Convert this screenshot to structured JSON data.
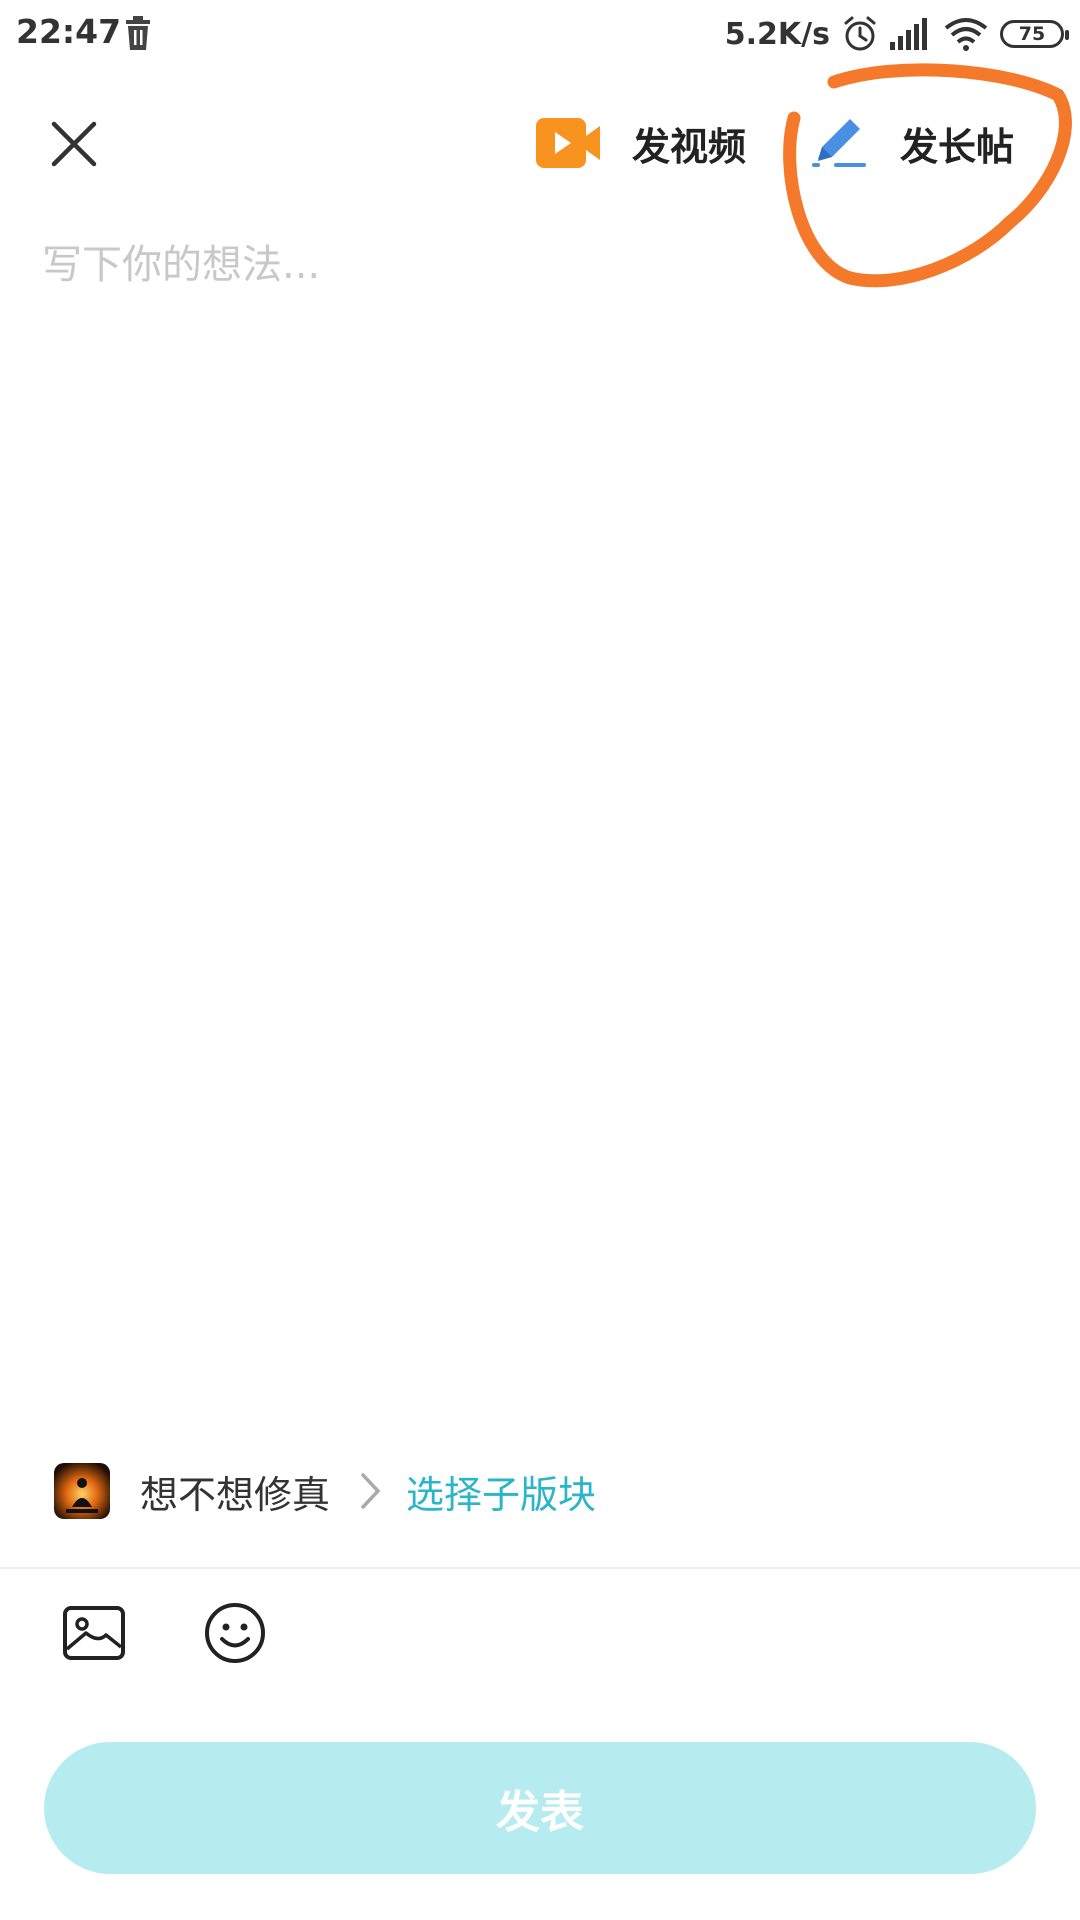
{
  "status_bar": {
    "time": "22:47",
    "net_speed": "5.2K/s",
    "battery": "75",
    "icons": [
      "trash-icon",
      "alarm-icon",
      "signal-icon",
      "wifi-icon",
      "battery-icon"
    ]
  },
  "header": {
    "close_icon": "close-icon",
    "video_label": "发视频",
    "long_post_label": "发长帖"
  },
  "editor": {
    "placeholder": "写下你的想法..."
  },
  "forum": {
    "name": "想不想修真",
    "select_sub_label": "选择子版块"
  },
  "toolbar": {
    "icons": [
      "image-icon",
      "emoji-icon"
    ]
  },
  "footer": {
    "publish_label": "发表"
  },
  "colors": {
    "accent": "#2bb5c8",
    "publish_bg": "#b6ecef",
    "video_icon": "#f7931e",
    "pen_icon": "#4a90e2",
    "annotation": "#f5792a"
  }
}
